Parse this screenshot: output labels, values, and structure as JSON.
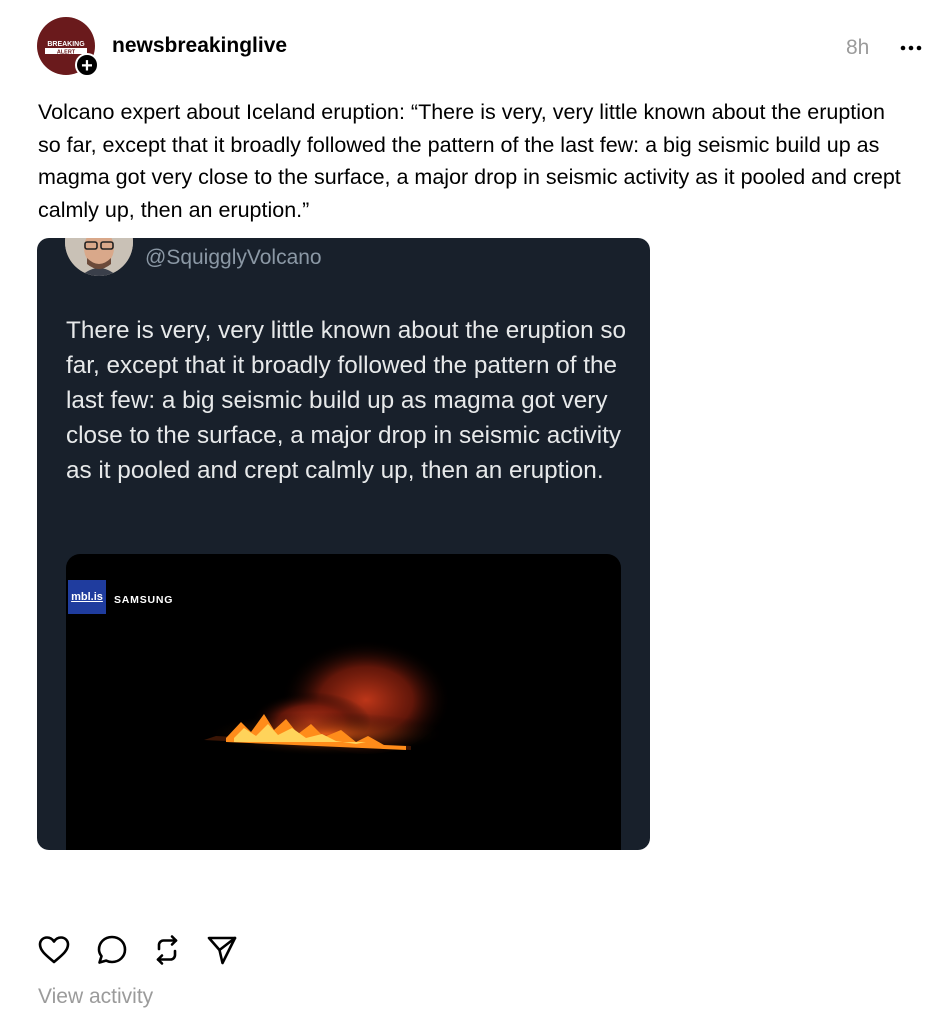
{
  "post": {
    "username": "newsbreakinglive",
    "timestamp": "8h",
    "avatar_text": "BREAKING ALERT",
    "caption": "Volcano expert about Iceland eruption: “There is very, very little known about the eruption so far, except that it broadly followed the pattern of the last few: a big seismic build up as magma got very close to the surface, a major drop in seismic activity as it pooled and crept calmly up, then an eruption.”"
  },
  "embed": {
    "handle": "@SquigglyVolcano",
    "text": "There is very, very little known about the eruption so far, except that it broadly followed the pattern of the last few: a big seismic build up as magma got very close to the surface, a major drop in seismic activity as it pooled and crept calmly up, then an eruption.",
    "video": {
      "logo": "mbl.is",
      "sponsor": "SAMSUNG"
    }
  },
  "actions": {
    "icons": [
      "heart-icon",
      "comment-icon",
      "repost-icon",
      "share-icon"
    ],
    "view_activity": "View activity"
  },
  "colors": {
    "embed_bg": "#18202b",
    "text_secondary": "#9b9b9b",
    "handle": "#8b98a5"
  }
}
